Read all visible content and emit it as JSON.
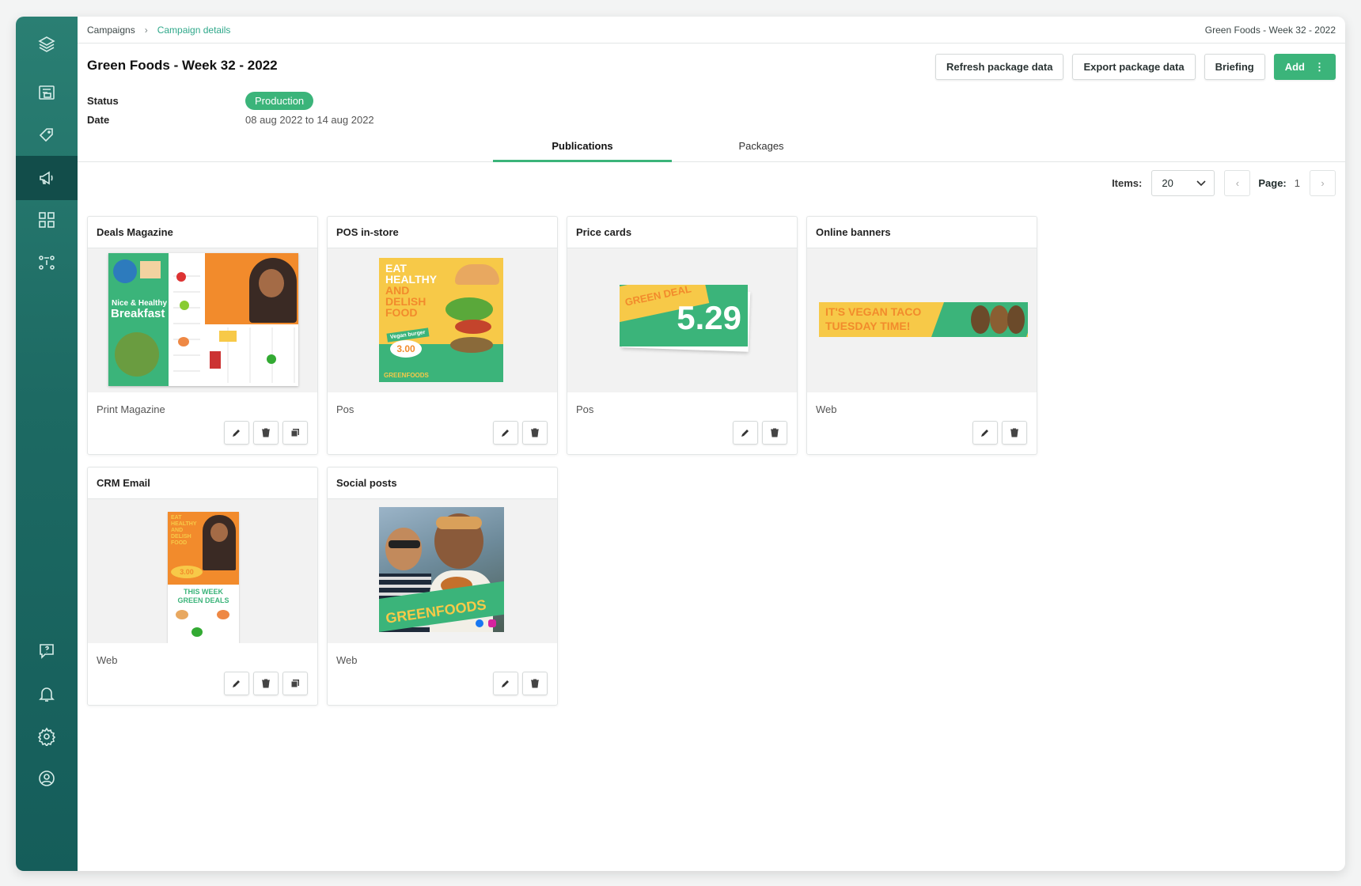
{
  "breadcrumb": {
    "items": [
      "Campaigns",
      "Campaign details"
    ],
    "separator": "›"
  },
  "topbar": {
    "campaign": "Green Foods - Week 32 - 2022"
  },
  "page": {
    "title": "Green Foods - Week 32 - 2022"
  },
  "actions": {
    "refresh": "Refresh package data",
    "export": "Export package data",
    "briefing": "Briefing",
    "add": "Add",
    "add_more": "⋮"
  },
  "meta": {
    "status_label": "Status",
    "status_value": "Production",
    "date_label": "Date",
    "date_value": "08 aug 2022 to 14 aug 2022"
  },
  "tabs": [
    "Publications",
    "Packages"
  ],
  "pager": {
    "items_label": "Items:",
    "items_value": "20",
    "page_label": "Page:",
    "page_value": "1",
    "prev": "‹",
    "next": "›"
  },
  "colors": {
    "accent": "#3bb47a",
    "sidebar": "#1d6a63",
    "brand_orange": "#f28b2c",
    "brand_yellow": "#f7c948"
  },
  "publications": [
    {
      "title": "Deals Magazine",
      "type": "Print Magazine",
      "actions": [
        "edit",
        "delete",
        "duplicate"
      ]
    },
    {
      "title": "POS in-store",
      "type": "Pos",
      "actions": [
        "edit",
        "delete"
      ]
    },
    {
      "title": "Price cards",
      "type": "Pos",
      "actions": [
        "edit",
        "delete"
      ]
    },
    {
      "title": "Online banners",
      "type": "Web",
      "actions": [
        "edit",
        "delete"
      ]
    },
    {
      "title": "CRM Email",
      "type": "Web",
      "actions": [
        "edit",
        "delete",
        "duplicate"
      ]
    },
    {
      "title": "Social posts",
      "type": "Web",
      "actions": [
        "edit",
        "delete"
      ]
    }
  ],
  "thumbs": {
    "magazine": {
      "headline": "Nice & Healthy",
      "sub": "Breakfast"
    },
    "pos": {
      "l1": "EAT",
      "l2": "HEALTHY",
      "l3": "AND",
      "l4": "DELISH",
      "l5": "FOOD",
      "tag": "Vegan burger",
      "price": "3.00",
      "brand": "GREENFOODS"
    },
    "price_card": {
      "label": "GREEN DEAL",
      "price": "5.29"
    },
    "banner": {
      "l1": "IT'S VEGAN TACO",
      "l2": "TUESDAY TIME!"
    },
    "email": {
      "l1": "EAT HEALTHY AND DELISH FOOD",
      "price": "3.00",
      "deals1": "THIS WEEK",
      "deals2": "GREEN DEALS"
    },
    "social": {
      "brand": "GREENFOODS"
    }
  },
  "sidebar": {
    "icons": [
      "layers-icon",
      "media-icon",
      "tag-icon",
      "megaphone-icon",
      "dashboard-icon",
      "workflow-icon",
      "help-chat-icon",
      "bell-icon",
      "settings-icon",
      "user-icon"
    ]
  }
}
